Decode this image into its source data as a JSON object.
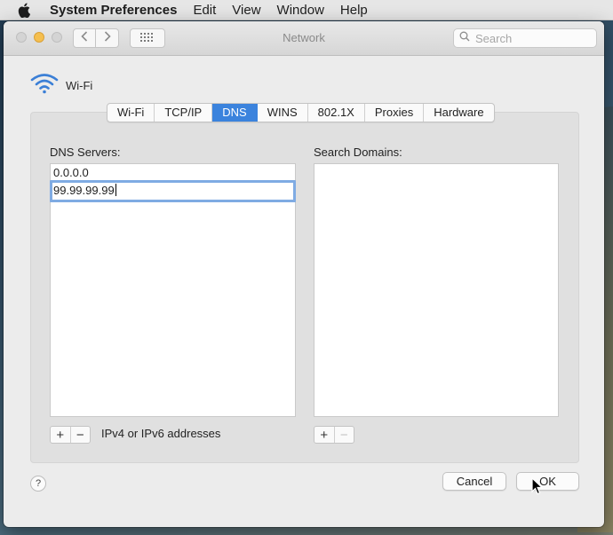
{
  "menubar": {
    "app_name": "System Preferences",
    "items": [
      "Edit",
      "View",
      "Window",
      "Help"
    ]
  },
  "window": {
    "title": "Network",
    "search_placeholder": "Search"
  },
  "service": {
    "name": "Wi-Fi"
  },
  "tabs": [
    {
      "label": "Wi-Fi",
      "active": false
    },
    {
      "label": "TCP/IP",
      "active": false
    },
    {
      "label": "DNS",
      "active": true
    },
    {
      "label": "WINS",
      "active": false
    },
    {
      "label": "802.1X",
      "active": false
    },
    {
      "label": "Proxies",
      "active": false
    },
    {
      "label": "Hardware",
      "active": false
    }
  ],
  "dns": {
    "servers_label": "DNS Servers:",
    "servers": [
      "0.0.0.0",
      "99.99.99.99"
    ],
    "hint": "IPv4 or IPv6 addresses"
  },
  "search_domains": {
    "label": "Search Domains:",
    "domains": []
  },
  "buttons": {
    "help": "?",
    "cancel": "Cancel",
    "ok": "OK",
    "plus": "+",
    "minus": "−"
  },
  "colors": {
    "accent": "#3b83dd",
    "focus_ring": "#7fabe3",
    "minimize": "#f5bf4f",
    "wifi_icon": "#3b7fd6"
  }
}
